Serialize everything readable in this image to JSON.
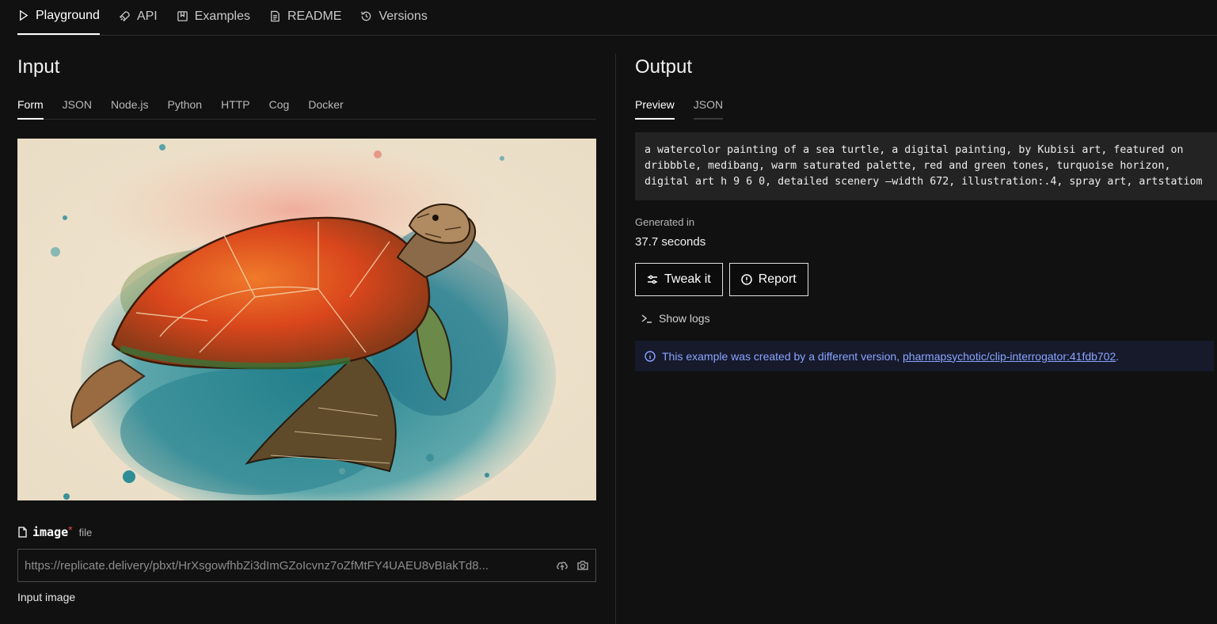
{
  "topnav": {
    "tabs": [
      {
        "label": "Playground",
        "icon": "play-icon",
        "active": true
      },
      {
        "label": "API",
        "icon": "rocket-icon"
      },
      {
        "label": "Examples",
        "icon": "bookmark-icon"
      },
      {
        "label": "README",
        "icon": "document-icon"
      },
      {
        "label": "Versions",
        "icon": "history-icon"
      }
    ]
  },
  "input": {
    "title": "Input",
    "tabs": [
      "Form",
      "JSON",
      "Node.js",
      "Python",
      "HTTP",
      "Cog",
      "Docker"
    ],
    "field": {
      "name": "image",
      "required_mark": "*",
      "type": "file",
      "value": "https://replicate.delivery/pbxt/HrXsgowfhbZi3dImGZoIcvnz7oZfMtFY4UAEU8vBIakTd8...",
      "help": "Input image"
    }
  },
  "output": {
    "title": "Output",
    "tabs": [
      "Preview",
      "JSON"
    ],
    "prompt": "a watercolor painting of a sea turtle, a digital painting, by Kubisi art, featured on dribbble, medibang, warm saturated palette, red and green tones, turquoise horizon, digital art h 9 6 0, detailed scenery —width 672, illustration:.4, spray art, artstatiom",
    "generated_label": "Generated in",
    "generated_value": "37.7 seconds",
    "tweak_label": "Tweak it",
    "report_label": "Report",
    "logs_label": "Show logs",
    "notice_text": "This example was created by a different version, ",
    "notice_link": "pharmapsychotic/clip-interrogator:41fdb702",
    "notice_end": "."
  },
  "colors": {
    "background": "#111111",
    "notice_bg": "#161a2b",
    "link": "#8aa4ff",
    "required": "#e5484d"
  }
}
